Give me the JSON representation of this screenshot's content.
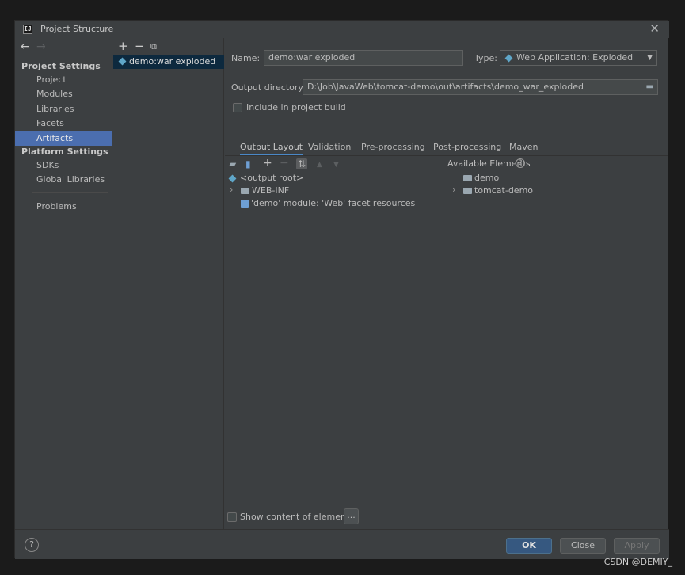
{
  "window": {
    "title": "Project Structure"
  },
  "sidebar": {
    "project_settings_header": "Project Settings",
    "project_items": [
      "Project",
      "Modules",
      "Libraries",
      "Facets",
      "Artifacts"
    ],
    "platform_settings_header": "Platform Settings",
    "platform_items": [
      "SDKs",
      "Global Libraries"
    ],
    "problems": "Problems",
    "selected": "Artifacts"
  },
  "artifacts_list": {
    "items": [
      "demo:war exploded"
    ],
    "toolbar": [
      "+",
      "−",
      "copy"
    ]
  },
  "form": {
    "name_label": "Name:",
    "name_value": "demo:war exploded",
    "type_label": "Type:",
    "type_value": "Web Application: Exploded",
    "output_dir_label": "Output directory:",
    "output_dir_value": "D:\\Job\\JavaWeb\\tomcat-demo\\out\\artifacts\\demo_war_exploded",
    "include_in_build": "Include in project build"
  },
  "tabs": [
    "Output Layout",
    "Validation",
    "Pre-processing",
    "Post-processing",
    "Maven"
  ],
  "active_tab": "Output Layout",
  "layout_tree": {
    "root": "<output root>",
    "web_inf": "WEB-INF",
    "facet_resources": "'demo' module: 'Web' facet resources"
  },
  "available": {
    "header": "Available Elements",
    "help": "?",
    "items": [
      "demo",
      "tomcat-demo"
    ]
  },
  "show_content": "Show content of elements",
  "ellipsis": "...",
  "buttons": {
    "help": "?",
    "ok": "OK",
    "close": "Close",
    "apply": "Apply"
  },
  "watermark": "CSDN @DEMIY_",
  "colors": {
    "background": "#3c3f41",
    "selection": "#4b6eaf",
    "primary": "#365880"
  },
  "icons": {
    "toolbar": [
      "add-icon",
      "remove-icon",
      "copy-icon"
    ],
    "layout_toolbar": [
      "new-folder-icon",
      "archive-icon",
      "add-icon",
      "remove-icon",
      "sort-icon",
      "move-up-icon",
      "move-down-icon"
    ]
  }
}
